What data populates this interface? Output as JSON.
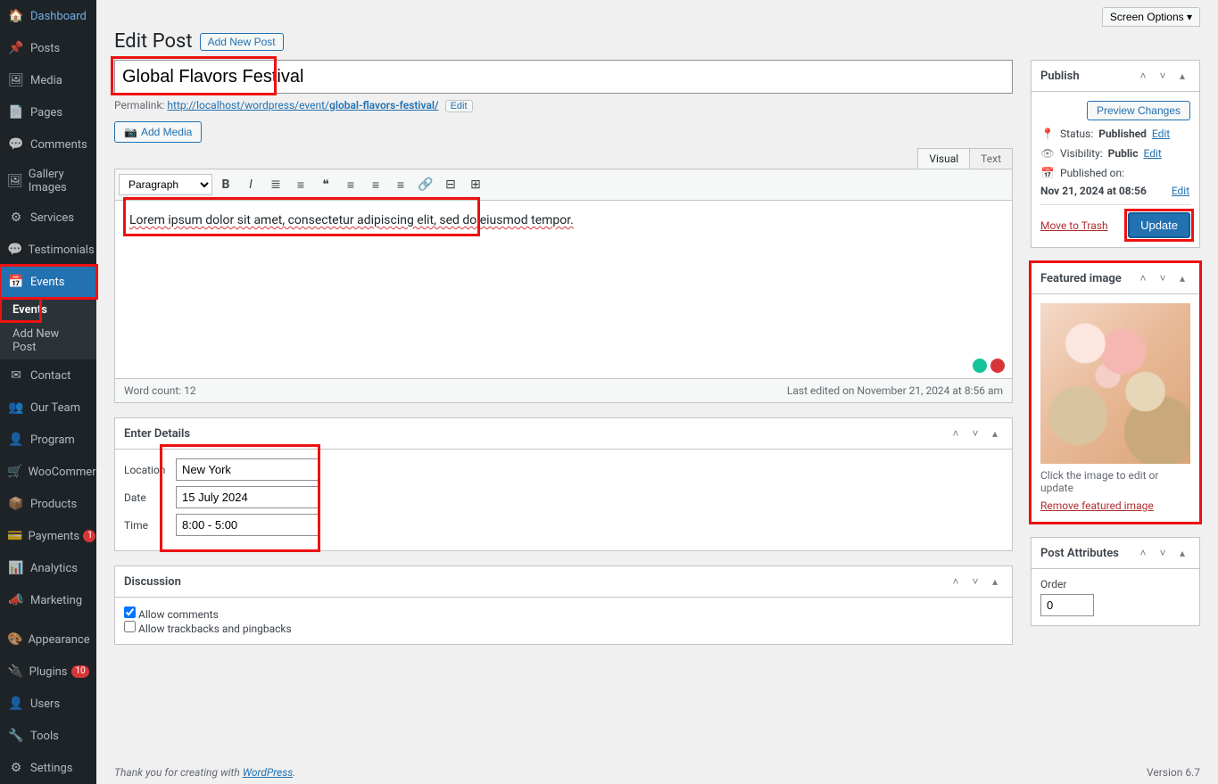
{
  "screen_options": "Screen Options ▾",
  "page_title": "Edit Post",
  "add_new": "Add New Post",
  "post_title": "Global Flavors Festival",
  "permalink": {
    "label": "Permalink:",
    "base": "http://localhost/wordpress/event/",
    "slug": "global-flavors-festival/",
    "edit": "Edit"
  },
  "add_media_label": "Add Media",
  "editor": {
    "visual_tab": "Visual",
    "text_tab": "Text",
    "format": "Paragraph",
    "content": "Lorem ipsum dolor sit amet, consectetur adipiscing elit, sed do eiusmod tempor.",
    "word_count": "Word count: 12",
    "last_edited": "Last edited on November 21, 2024 at 8:56 am"
  },
  "details_box": {
    "title": "Enter Details",
    "location_label": "Location",
    "location_value": "New York",
    "date_label": "Date",
    "date_value": "15 July 2024",
    "time_label": "Time",
    "time_value": "8:00 - 5:00"
  },
  "discussion_box": {
    "title": "Discussion",
    "allow_comments": "Allow comments",
    "allow_trackbacks": "Allow trackbacks and pingbacks"
  },
  "publish": {
    "title": "Publish",
    "preview": "Preview Changes",
    "status_label": "Status:",
    "status_value": "Published",
    "visibility_label": "Visibility:",
    "visibility_value": "Public",
    "published_label": "Published on:",
    "published_value": "Nov 21, 2024 at 08:56",
    "edit": "Edit",
    "trash": "Move to Trash",
    "update": "Update"
  },
  "featured": {
    "title": "Featured image",
    "caption": "Click the image to edit or update",
    "remove": "Remove featured image"
  },
  "post_attributes": {
    "title": "Post Attributes",
    "order_label": "Order",
    "order_value": "0"
  },
  "footer": {
    "credit_pre": "Thank you for creating with ",
    "credit_link": "WordPress",
    "version": "Version 6.7"
  },
  "sidebar": {
    "items": [
      {
        "icon": "🏠",
        "label": "Dashboard"
      },
      {
        "icon": "📌",
        "label": "Posts"
      },
      {
        "icon": "🖼",
        "label": "Media"
      },
      {
        "icon": "📄",
        "label": "Pages"
      },
      {
        "icon": "💬",
        "label": "Comments"
      },
      {
        "icon": "🖼",
        "label": "Gallery Images"
      },
      {
        "icon": "⚙",
        "label": "Services"
      },
      {
        "icon": "💬",
        "label": "Testimonials"
      },
      {
        "icon": "📅",
        "label": "Events",
        "current": true
      },
      {
        "icon": "✉",
        "label": "Contact"
      },
      {
        "icon": "👥",
        "label": "Our Team"
      },
      {
        "icon": "👤",
        "label": "Program"
      },
      {
        "icon": "🛒",
        "label": "WooCommerce"
      },
      {
        "icon": "📦",
        "label": "Products"
      },
      {
        "icon": "💳",
        "label": "Payments",
        "badge": "1"
      },
      {
        "icon": "📊",
        "label": "Analytics"
      },
      {
        "icon": "📣",
        "label": "Marketing"
      },
      {
        "icon": "🎨",
        "label": "Appearance"
      },
      {
        "icon": "🔌",
        "label": "Plugins",
        "badge": "10"
      },
      {
        "icon": "👤",
        "label": "Users"
      },
      {
        "icon": "🔧",
        "label": "Tools"
      },
      {
        "icon": "⚙",
        "label": "Settings"
      }
    ],
    "submenu": [
      {
        "label": "Events",
        "current": true
      },
      {
        "label": "Add New Post"
      }
    ]
  }
}
